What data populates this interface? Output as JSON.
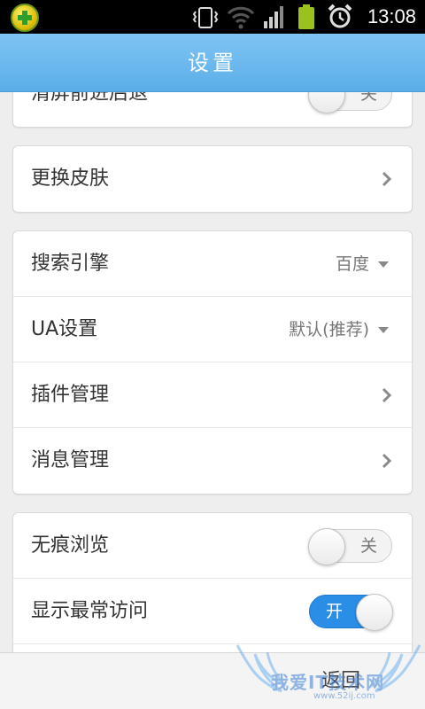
{
  "status_bar": {
    "time": "13:08",
    "icons": [
      "app-360-icon",
      "vibrate-icon",
      "wifi-icon",
      "signal-icon",
      "battery-icon",
      "alarm-icon"
    ]
  },
  "header": {
    "title": "设置"
  },
  "sections": {
    "top": {
      "label": "清屏前进后退",
      "toggle_text": "关",
      "toggle_on": false
    },
    "skin": {
      "label": "更换皮肤"
    },
    "main": {
      "search_engine": {
        "label": "搜索引擎",
        "value": "百度"
      },
      "ua": {
        "label": "UA设置",
        "value": "默认(推荐)"
      },
      "plugins": {
        "label": "插件管理"
      },
      "messages": {
        "label": "消息管理"
      }
    },
    "privacy": {
      "incognito": {
        "label": "无痕浏览",
        "toggle_text": "关",
        "toggle_on": false
      },
      "most_visited": {
        "label": "显示最常访问",
        "toggle_text": "开",
        "toggle_on": true
      }
    }
  },
  "bottom_bar": {
    "back_label": "返回"
  },
  "watermark": {
    "text": "我爱IT技术网",
    "sub": "www.52ij.com"
  },
  "colors": {
    "title_bar": "#6ab8ef",
    "toggle_on": "#2b8ee6",
    "background": "#eeeeee"
  }
}
